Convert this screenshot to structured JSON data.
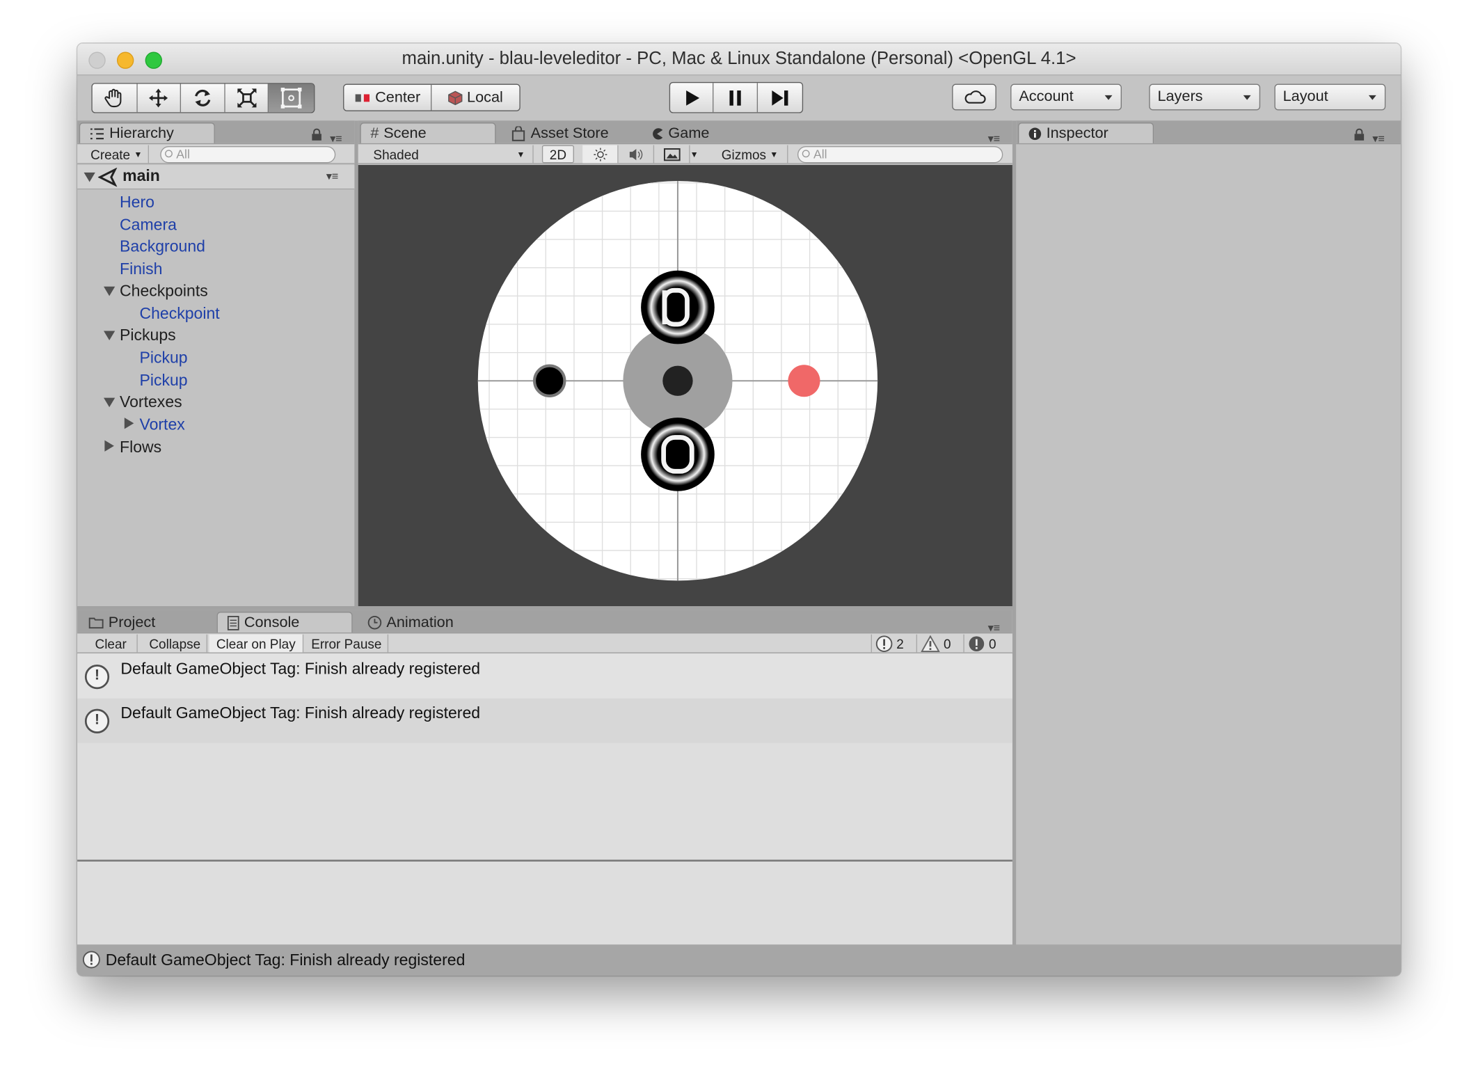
{
  "window": {
    "title": "main.unity - blau-leveleditor - PC, Mac & Linux Standalone (Personal) <OpenGL 4.1>"
  },
  "toolbar": {
    "tools": [
      {
        "icon": "hand-icon"
      },
      {
        "icon": "move-icon"
      },
      {
        "icon": "rotate-icon"
      },
      {
        "icon": "scale-icon"
      },
      {
        "icon": "rect-tool-icon"
      }
    ],
    "pivot_center": "Center",
    "pivot_local": "Local",
    "play_icon": "play-icon",
    "pause_icon": "pause-icon",
    "step_icon": "step-icon",
    "cloud_icon": "cloud-icon",
    "account": "Account",
    "layers": "Layers",
    "layout": "Layout"
  },
  "hierarchy": {
    "tab": "Hierarchy",
    "create": "Create",
    "search_placeholder": "All",
    "scene_name": "main",
    "items": [
      {
        "label": "Hero",
        "prefab": true
      },
      {
        "label": "Camera",
        "prefab": true
      },
      {
        "label": "Background",
        "prefab": true
      },
      {
        "label": "Finish",
        "prefab": true
      },
      {
        "label": "Checkpoints",
        "prefab": false,
        "expanded": true
      },
      {
        "label": "Checkpoint",
        "prefab": true
      },
      {
        "label": "Pickups",
        "prefab": false,
        "expanded": true
      },
      {
        "label": "Pickup",
        "prefab": true
      },
      {
        "label": "Pickup",
        "prefab": true
      },
      {
        "label": "Vortexes",
        "prefab": false,
        "expanded": true
      },
      {
        "label": "Vortex",
        "prefab": true,
        "expanded": false
      },
      {
        "label": "Flows",
        "prefab": false,
        "expanded": false
      }
    ]
  },
  "scene": {
    "tabs": [
      "Scene",
      "Asset Store",
      "Game"
    ],
    "shading": "Shaded",
    "mode_2d": "2D",
    "gizmos": "Gizmos",
    "search_placeholder": "All",
    "colors": {
      "background": "#444444",
      "disc": "#ffffff",
      "red_dot": "#f06868",
      "gray_disc": "#a0a0a0"
    }
  },
  "inspector": {
    "tab": "Inspector"
  },
  "bottom": {
    "tabs": [
      "Project",
      "Console",
      "Animation"
    ],
    "buttons": [
      "Clear",
      "Collapse",
      "Clear on Play",
      "Error Pause"
    ],
    "counts": {
      "info": "2",
      "warning": "0",
      "error": "0"
    },
    "messages": [
      "Default GameObject Tag: Finish already registered",
      "Default GameObject Tag: Finish already registered"
    ]
  },
  "status": {
    "message": "Default GameObject Tag: Finish already registered"
  }
}
